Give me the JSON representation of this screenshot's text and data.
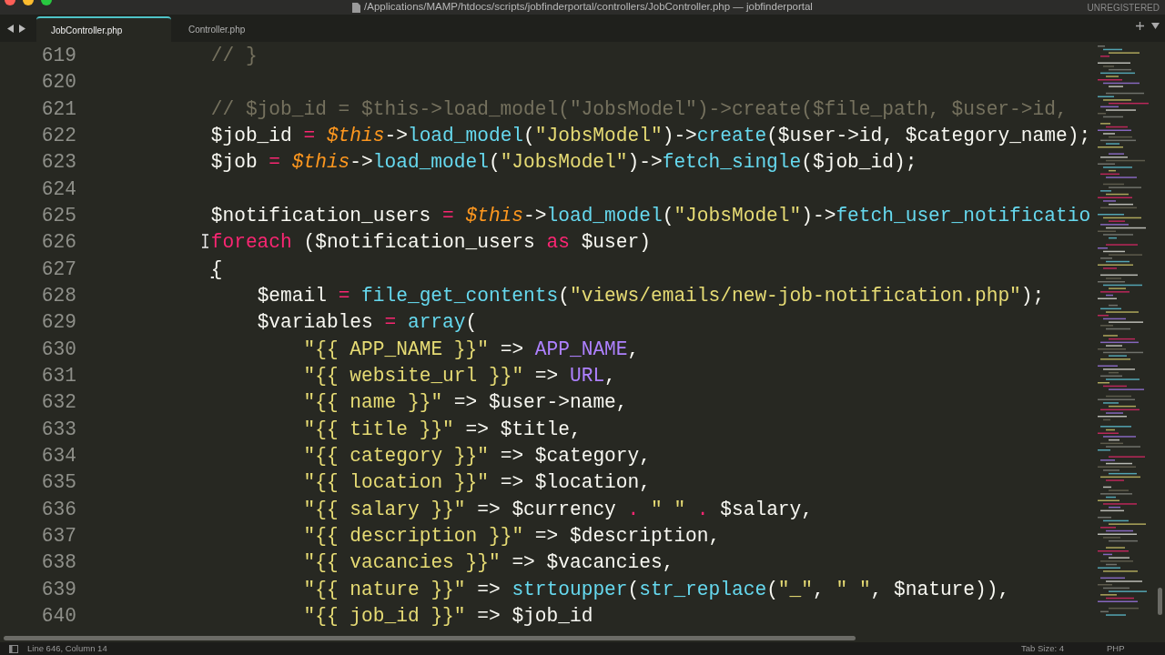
{
  "window": {
    "title": "/Applications/MAMP/htdocs/scripts/jobfinderportal/controllers/JobController.php — jobfinderportal",
    "badge": "UNREGISTERED"
  },
  "tabs": [
    {
      "label": "JobController.php",
      "selected": true
    },
    {
      "label": "Controller.php",
      "selected": false
    }
  ],
  "editor": {
    "lines": [
      {
        "number": "619",
        "tokens": [
          {
            "kind": "comment",
            "text": "        // }"
          }
        ]
      },
      {
        "number": "620"
      },
      {
        "number": "621",
        "tokens": [
          {
            "kind": "comment",
            "text": "        // $job_id = $this->load_model(\"JobsModel\")->create($file_path, $user->id,"
          }
        ]
      },
      {
        "number": "622",
        "tokens": [
          {
            "kind": "plain",
            "text": "        $job_id "
          },
          {
            "kind": "operator",
            "text": "="
          },
          {
            "kind": "this",
            "text": " $this"
          },
          {
            "kind": "plain",
            "text": "->"
          },
          {
            "kind": "function",
            "text": "load_model"
          },
          {
            "kind": "plain",
            "text": "("
          },
          {
            "kind": "string",
            "text": "\"JobsModel\""
          },
          {
            "kind": "plain",
            "text": ")->"
          },
          {
            "kind": "function",
            "text": "create"
          },
          {
            "kind": "plain",
            "text": "($user->id, $category_name);"
          }
        ]
      },
      {
        "number": "623",
        "tokens": [
          {
            "kind": "plain",
            "text": "        $job "
          },
          {
            "kind": "operator",
            "text": "="
          },
          {
            "kind": "this",
            "text": " $this"
          },
          {
            "kind": "plain",
            "text": "->"
          },
          {
            "kind": "function",
            "text": "load_model"
          },
          {
            "kind": "plain",
            "text": "("
          },
          {
            "kind": "string",
            "text": "\"JobsModel\""
          },
          {
            "kind": "plain",
            "text": ")->"
          },
          {
            "kind": "function",
            "text": "fetch_single"
          },
          {
            "kind": "plain",
            "text": "($job_id);"
          }
        ]
      },
      {
        "number": "624"
      },
      {
        "number": "625",
        "tokens": [
          {
            "kind": "plain",
            "text": "        $notification_users "
          },
          {
            "kind": "operator",
            "text": "="
          },
          {
            "kind": "this",
            "text": " $this"
          },
          {
            "kind": "plain",
            "text": "->"
          },
          {
            "kind": "function",
            "text": "load_model"
          },
          {
            "kind": "plain",
            "text": "("
          },
          {
            "kind": "string",
            "text": "\"JobsModel\""
          },
          {
            "kind": "plain",
            "text": ")->"
          },
          {
            "kind": "function",
            "text": "fetch_user_notificatio"
          }
        ]
      },
      {
        "number": "626",
        "tokens": [
          {
            "kind": "keyword",
            "text": "        foreach"
          },
          {
            "kind": "plain",
            "text": " ($notification_users "
          },
          {
            "kind": "keyword",
            "text": "as"
          },
          {
            "kind": "plain",
            "text": " $user)"
          }
        ]
      },
      {
        "number": "627",
        "tokens": [
          {
            "kind": "bracket",
            "text": "        {"
          }
        ]
      },
      {
        "number": "628",
        "tokens": [
          {
            "kind": "plain",
            "text": "            $email "
          },
          {
            "kind": "operator",
            "text": "="
          },
          {
            "kind": "function",
            "text": " file_get_contents"
          },
          {
            "kind": "plain",
            "text": "("
          },
          {
            "kind": "string",
            "text": "\"views/emails/new-job-notification.php\""
          },
          {
            "kind": "plain",
            "text": ");"
          }
        ]
      },
      {
        "number": "629",
        "tokens": [
          {
            "kind": "plain",
            "text": "            $variables "
          },
          {
            "kind": "operator",
            "text": "="
          },
          {
            "kind": "function",
            "text": " array"
          },
          {
            "kind": "plain",
            "text": "("
          }
        ]
      },
      {
        "number": "630",
        "tokens": [
          {
            "kind": "string",
            "text": "                \"{{ APP_NAME }}\""
          },
          {
            "kind": "plain",
            "text": " => "
          },
          {
            "kind": "constant",
            "text": "APP_NAME"
          },
          {
            "kind": "plain",
            "text": ","
          }
        ]
      },
      {
        "number": "631",
        "tokens": [
          {
            "kind": "string",
            "text": "                \"{{ website_url }}\""
          },
          {
            "kind": "plain",
            "text": " => "
          },
          {
            "kind": "constant",
            "text": "URL"
          },
          {
            "kind": "plain",
            "text": ","
          }
        ]
      },
      {
        "number": "632",
        "tokens": [
          {
            "kind": "string",
            "text": "                \"{{ name }}\""
          },
          {
            "kind": "plain",
            "text": " => $user->name,"
          }
        ]
      },
      {
        "number": "633",
        "tokens": [
          {
            "kind": "string",
            "text": "                \"{{ title }}\""
          },
          {
            "kind": "plain",
            "text": " => $title,"
          }
        ]
      },
      {
        "number": "634",
        "tokens": [
          {
            "kind": "string",
            "text": "                \"{{ category }}\""
          },
          {
            "kind": "plain",
            "text": " => $category,"
          }
        ]
      },
      {
        "number": "635",
        "tokens": [
          {
            "kind": "string",
            "text": "                \"{{ location }}\""
          },
          {
            "kind": "plain",
            "text": " => $location,"
          }
        ]
      },
      {
        "number": "636",
        "tokens": [
          {
            "kind": "string",
            "text": "                \"{{ salary }}\""
          },
          {
            "kind": "plain",
            "text": " => $currency "
          },
          {
            "kind": "operator",
            "text": "."
          },
          {
            "kind": "string",
            "text": " \" \""
          },
          {
            "kind": "operator",
            "text": " ."
          },
          {
            "kind": "plain",
            "text": " $salary,"
          }
        ]
      },
      {
        "number": "637",
        "tokens": [
          {
            "kind": "string",
            "text": "                \"{{ description }}\""
          },
          {
            "kind": "plain",
            "text": " => $description,"
          }
        ]
      },
      {
        "number": "638",
        "tokens": [
          {
            "kind": "string",
            "text": "                \"{{ vacancies }}\""
          },
          {
            "kind": "plain",
            "text": " => $vacancies,"
          }
        ]
      },
      {
        "number": "639",
        "tokens": [
          {
            "kind": "string",
            "text": "                \"{{ nature }}\""
          },
          {
            "kind": "plain",
            "text": " => "
          },
          {
            "kind": "function",
            "text": "strtoupper"
          },
          {
            "kind": "plain",
            "text": "("
          },
          {
            "kind": "function",
            "text": "str_replace"
          },
          {
            "kind": "plain",
            "text": "("
          },
          {
            "kind": "string",
            "text": "\"_\""
          },
          {
            "kind": "plain",
            "text": ", "
          },
          {
            "kind": "string",
            "text": "\" \""
          },
          {
            "kind": "plain",
            "text": ", $nature)),"
          }
        ]
      },
      {
        "number": "640",
        "tokens": [
          {
            "kind": "string",
            "text": "                \"{{ job_id }}\""
          },
          {
            "kind": "plain",
            "text": " => $job_id"
          }
        ]
      }
    ]
  },
  "status_bar": {
    "position": "Line 646, Column 14",
    "tab_size": "Tab Size: 4",
    "syntax": "PHP"
  }
}
